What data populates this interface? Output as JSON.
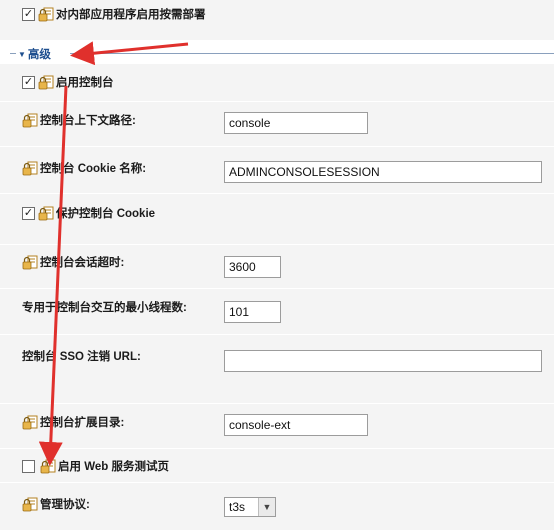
{
  "rows": {
    "deploy_on_demand": {
      "label": "对内部应用程序启用按需部署",
      "checked": true
    },
    "advanced": {
      "label": "高级"
    },
    "enable_console": {
      "label": "启用控制台",
      "checked": true
    },
    "context_path": {
      "label": "控制台上下文路径:",
      "value": "console"
    },
    "cookie_name": {
      "label": "控制台 Cookie 名称:",
      "value": "ADMINCONSOLESESSION"
    },
    "protect_cookie": {
      "label": "保护控制台 Cookie",
      "checked": true
    },
    "session_timeout": {
      "label": "控制台会话超时:",
      "value": "3600"
    },
    "min_threads": {
      "label": "专用于控制台交互的最小线程数:",
      "value": "101"
    },
    "sso_logout": {
      "label": "控制台 SSO 注销 URL:",
      "value": ""
    },
    "extension_dir": {
      "label": "控制台扩展目录:",
      "value": "console-ext"
    },
    "web_service_test": {
      "label": "启用 Web 服务测试页",
      "checked": false
    },
    "admin_protocol": {
      "label": "管理协议:",
      "value": "t3s"
    }
  },
  "glyphs": {
    "check": "✓",
    "collapse": "▼",
    "dropdown": "▼"
  },
  "icons": {
    "lock": "lock-icon",
    "section_toggle": "triangle-down-icon"
  },
  "colors": {
    "arrow": "#e0302c",
    "section_title": "#1e4f8f",
    "band": "#f4f4f4",
    "lock_body": "#e8b54a"
  }
}
